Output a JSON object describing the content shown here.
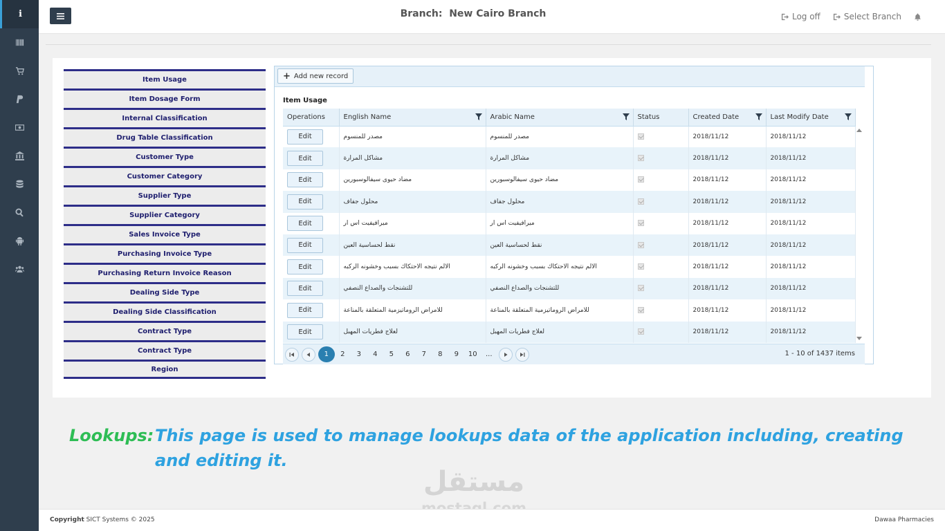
{
  "sidebar": {
    "items": [
      {
        "icon": "info-icon",
        "active": true
      },
      {
        "icon": "barcode-icon",
        "active": false
      },
      {
        "icon": "cart-icon",
        "active": false
      },
      {
        "icon": "paypal-icon",
        "active": false
      },
      {
        "icon": "money-icon",
        "active": false
      },
      {
        "icon": "bank-icon",
        "active": false
      },
      {
        "icon": "database-icon",
        "active": false
      },
      {
        "icon": "search-icon",
        "active": false
      },
      {
        "icon": "android-icon",
        "active": false
      },
      {
        "icon": "users-icon",
        "active": false
      }
    ]
  },
  "header": {
    "branch_label": "Branch:",
    "branch_name": "New Cairo Branch",
    "log_off": "Log off",
    "select_branch": "Select Branch"
  },
  "lookups": [
    "Item Usage",
    "Item Dosage Form",
    "Internal Classification",
    "Drug Table Classification",
    "Customer Type",
    "Customer Category",
    "Supplier Type",
    "Supplier Category",
    "Sales Invoice Type",
    "Purchasing Invoice Type",
    "Purchasing Return Invoice Reason",
    "Dealing Side Type",
    "Dealing Side Classification",
    "Contract Type",
    "Contract Type",
    "Region"
  ],
  "grid": {
    "add_label": "Add new record",
    "title": "Item Usage",
    "columns": [
      "Operations",
      "English Name",
      "Arabic Name",
      "Status",
      "Created Date",
      "Last Modify Date"
    ],
    "edit_label": "Edit",
    "rows": [
      {
        "en": "مصدر للمنسوم",
        "ar": "مصدر للمنسوم",
        "created": "2018/11/12",
        "modified": "2018/11/12"
      },
      {
        "en": "مشاكل المرارة",
        "ar": "مشاكل المرارة",
        "created": "2018/11/12",
        "modified": "2018/11/12"
      },
      {
        "en": "مضاد حيوى سيفالوسبورين",
        "ar": "مضاد حيوى سيفالوسبورين",
        "created": "2018/11/12",
        "modified": "2018/11/12"
      },
      {
        "en": "محلول جفاف",
        "ar": "محلول جفاف",
        "created": "2018/11/12",
        "modified": "2018/11/12"
      },
      {
        "en": "ميرافيفيت اس ار",
        "ar": "ميرافيفيت اس ار",
        "created": "2018/11/12",
        "modified": "2018/11/12"
      },
      {
        "en": "نقط لحساسية العين",
        "ar": "نقط لحساسية العين",
        "created": "2018/11/12",
        "modified": "2018/11/12"
      },
      {
        "en": "الالم نتيجه الاحتكاك بسبب وخشونه الركبه",
        "ar": "الالم نتيجه الاحتكاك بسبب وخشونه الركبه",
        "created": "2018/11/12",
        "modified": "2018/11/12"
      },
      {
        "en": "للتشنجات والصداع النصفي",
        "ar": "للتشنجات والصداع النصفي",
        "created": "2018/11/12",
        "modified": "2018/11/12"
      },
      {
        "en": "للامراض الروماتيزمية المتعلقة بالمناعة",
        "ar": "للامراض الروماتيزمية المتعلقة بالمناعة",
        "created": "2018/11/12",
        "modified": "2018/11/12"
      },
      {
        "en": "لعلاج فطريات المهبل",
        "ar": "لعلاج فطريات المهبل",
        "created": "2018/11/12",
        "modified": "2018/11/12"
      }
    ],
    "pages": [
      "1",
      "2",
      "3",
      "4",
      "5",
      "6",
      "7",
      "8",
      "9",
      "10",
      "..."
    ],
    "current_page": "1",
    "pager_info": "1 - 10 of 1437 items"
  },
  "caption": {
    "lead": "Lookups:",
    "body": "This page is used to manage lookups data of the application including, creating and editing it."
  },
  "watermark": {
    "arabic": "مستقل",
    "latin": "mostaql.com"
  },
  "footer": {
    "copyright_label": "Copyright",
    "copyright_text": "SICT Systems © 2025",
    "right": "Dawaa Pharmacies"
  },
  "colors": {
    "sidebar_bg": "#2f3e4d",
    "accent": "#2a7fb0",
    "lookup_border": "#2d2d88",
    "caption_lead": "#2ebd55",
    "caption_body": "#2ea2e0"
  }
}
